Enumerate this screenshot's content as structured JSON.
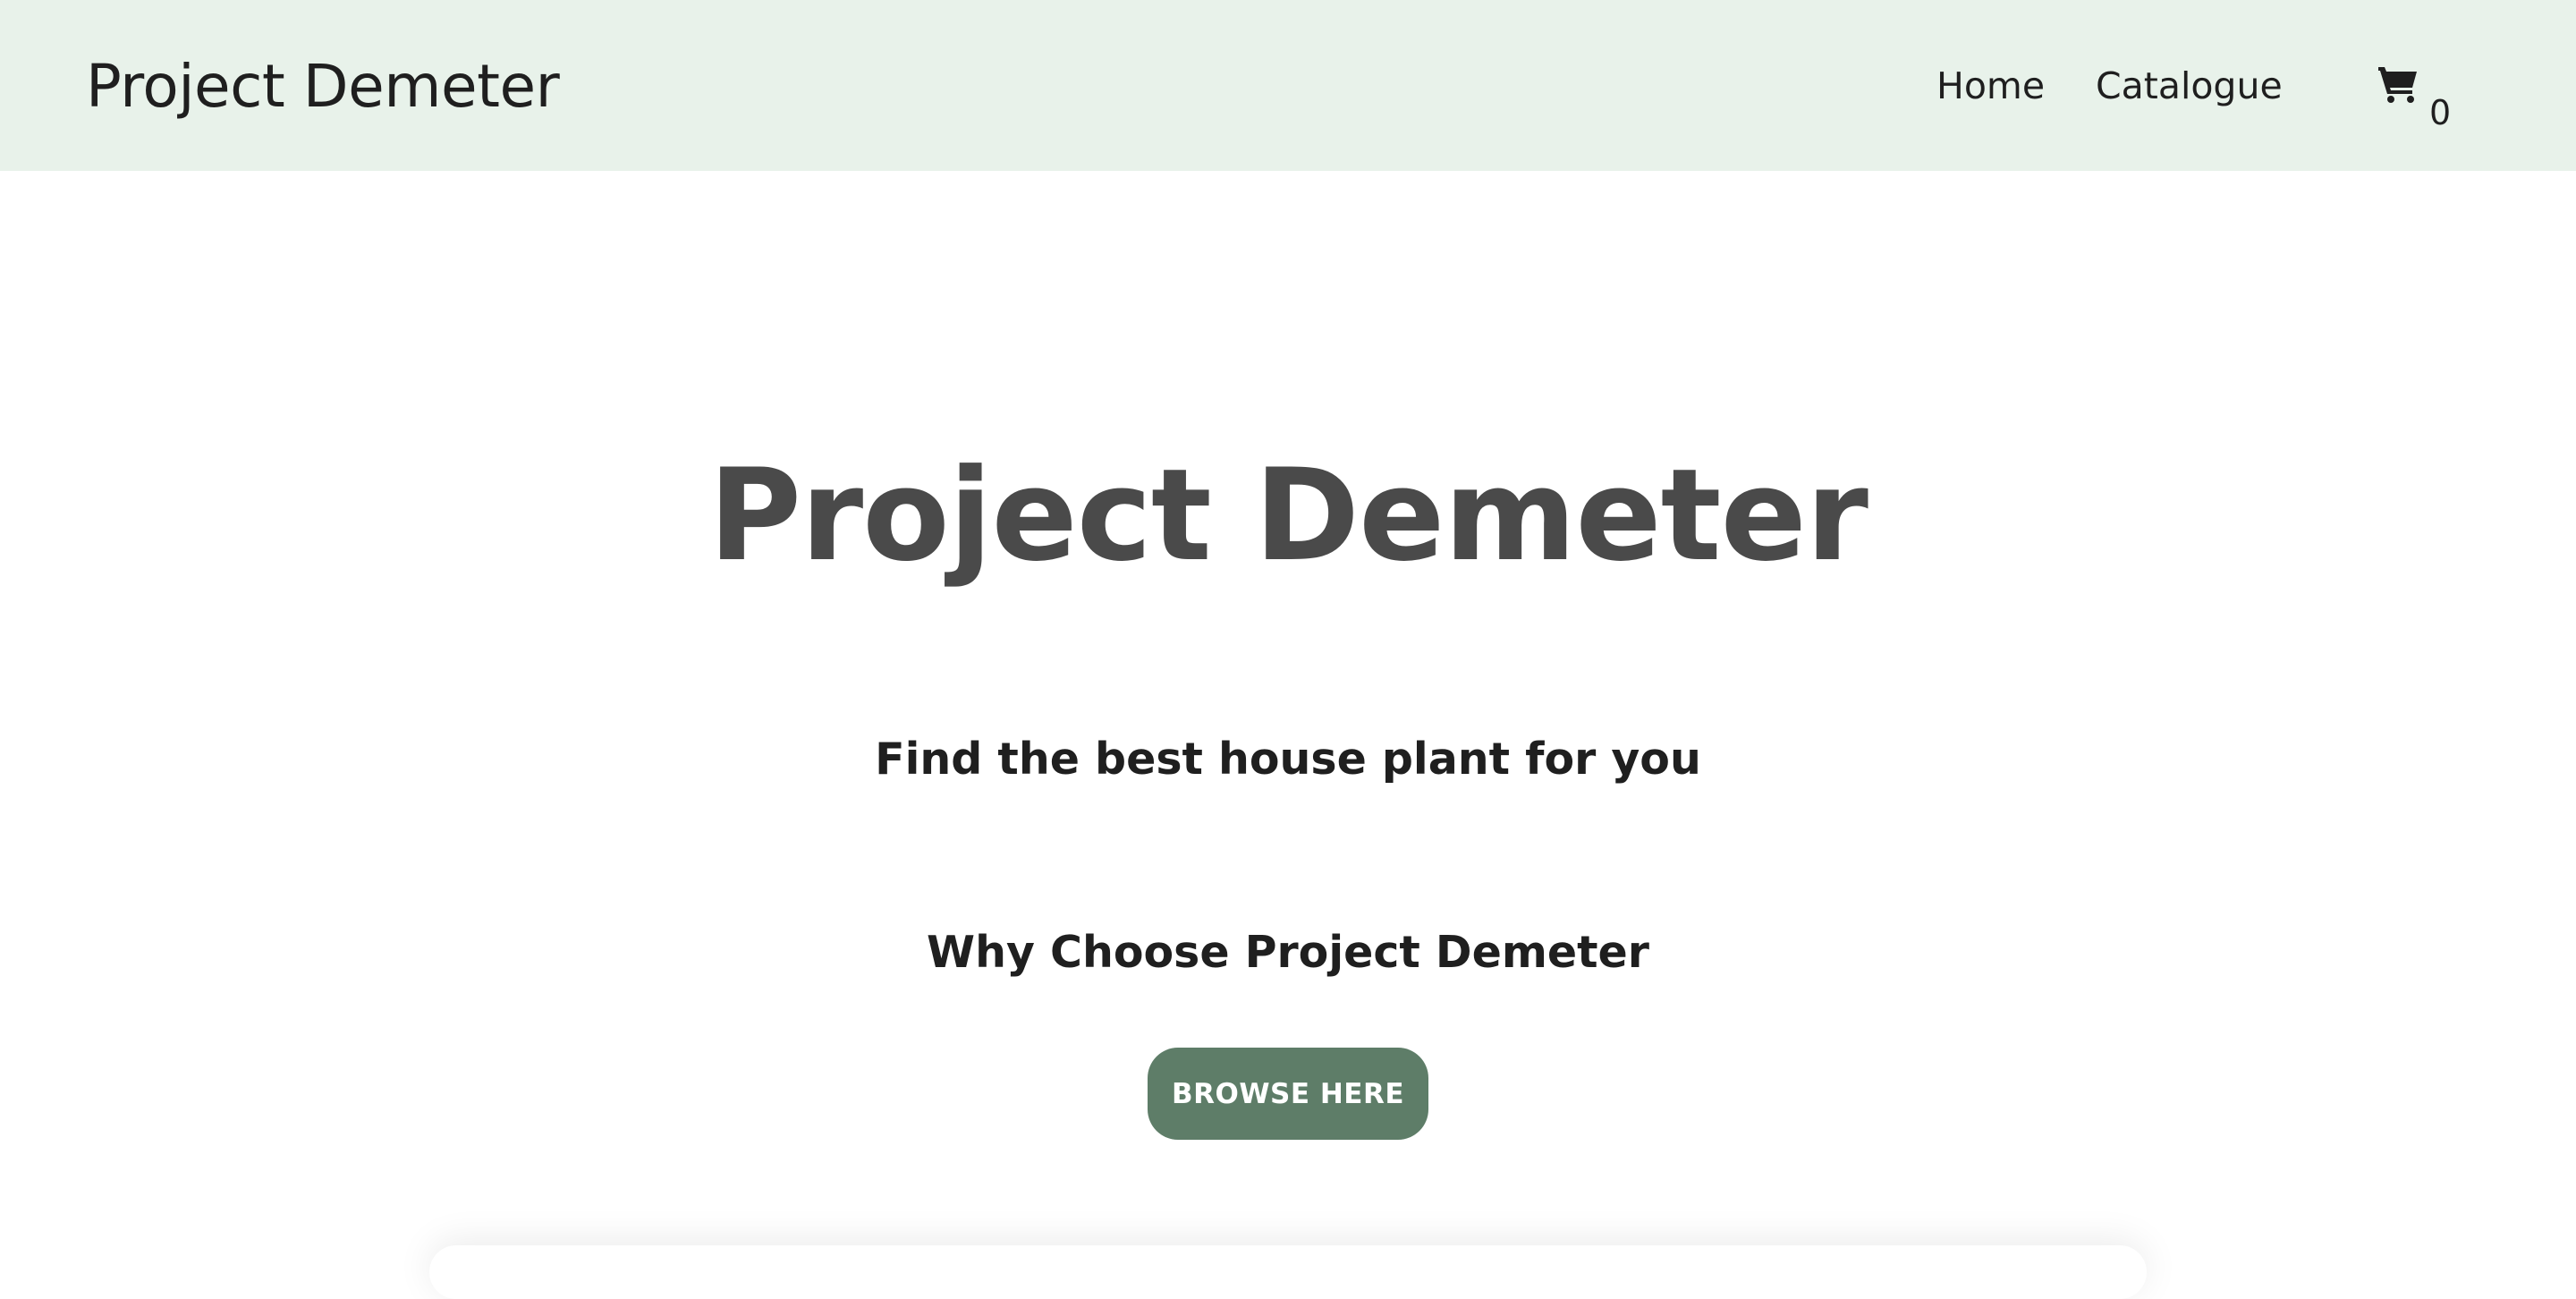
{
  "navbar": {
    "brand": "Project Demeter",
    "links": [
      {
        "label": "Home"
      },
      {
        "label": "Catalogue"
      }
    ],
    "cart": {
      "icon": "cart-icon",
      "count": "0"
    },
    "background_color": "#e8f2ea"
  },
  "hero": {
    "title": "Project Demeter",
    "subtitle": "Find the best house plant for you",
    "section_heading": "Why Choose Project Demeter",
    "cta_label": "BROWSE HERE",
    "cta_color": "#5e7d68"
  }
}
